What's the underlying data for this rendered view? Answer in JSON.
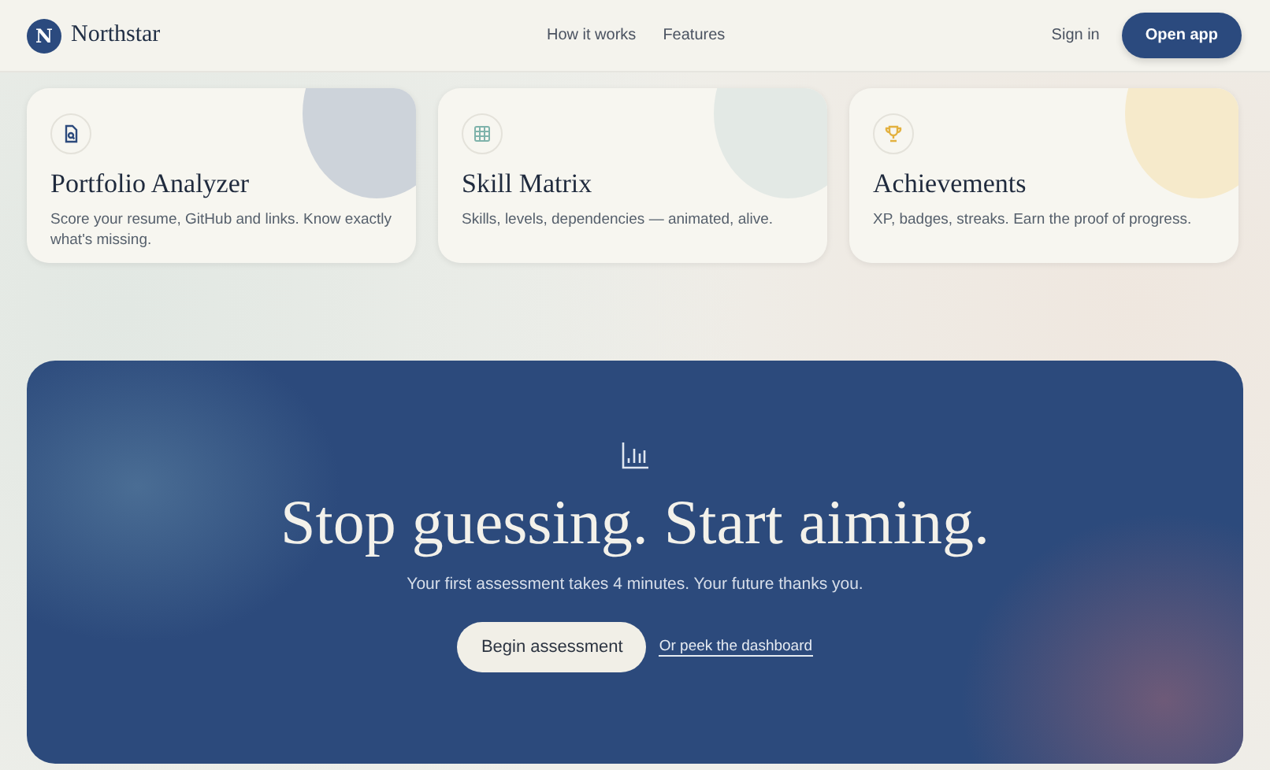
{
  "brand": {
    "mark": "N",
    "name": "Northstar"
  },
  "nav": {
    "links": [
      "How it works",
      "Features"
    ],
    "sign_in": "Sign in",
    "open_app": "Open app"
  },
  "features": [
    {
      "kind": "file",
      "color": "#cdd3da",
      "title": "Portfolio Analyzer",
      "text": "Score your resume, GitHub and links. Know exactly what's missing."
    },
    {
      "kind": "grid",
      "color": "#e3e9e5",
      "title": "Skill Matrix",
      "text": "Skills, levels, dependencies — animated, alive."
    },
    {
      "kind": "trophy",
      "color": "#f6eacb",
      "title": "Achievements",
      "text": "XP, badges, streaks. Earn the proof of progress."
    }
  ],
  "cta": {
    "title": "Stop guessing. Start aiming.",
    "subtitle": "Your first assessment takes 4 minutes. Your future thanks you.",
    "primary": "Begin assessment",
    "link": "Or peek the dashboard"
  }
}
